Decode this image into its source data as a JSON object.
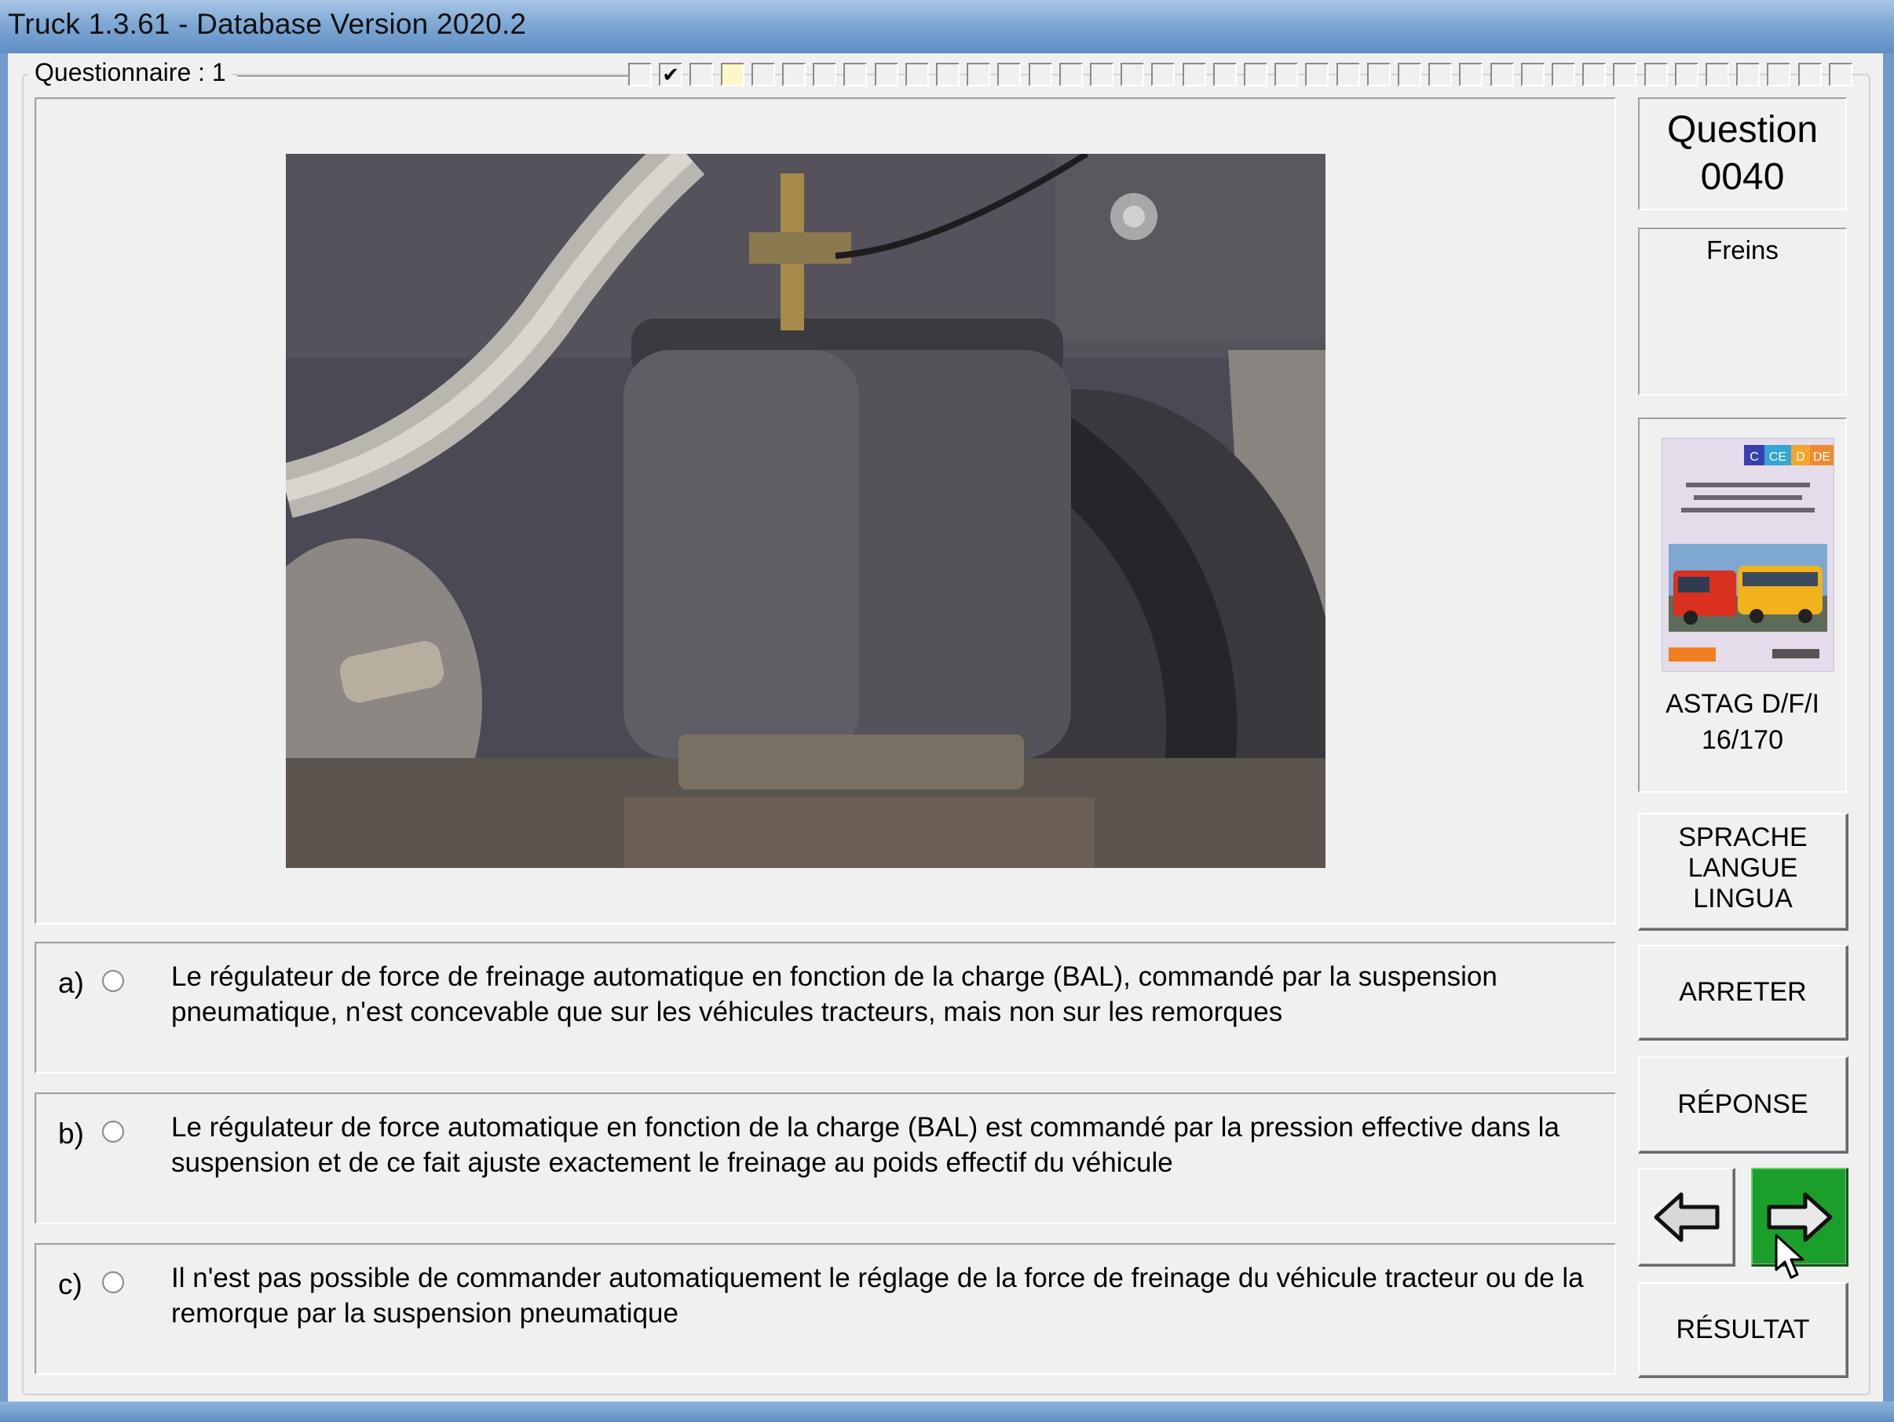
{
  "window": {
    "title": "Truck 1.3.61 - Database Version 2020.2"
  },
  "questionnaire": {
    "label": "Questionnaire : 1",
    "progress": {
      "total_boxes": 40,
      "checked_index": 1,
      "current_index": 3
    }
  },
  "question": {
    "title": "Question",
    "number": "0040",
    "category": "Freins"
  },
  "book": {
    "badge": [
      "C",
      "CE",
      "D",
      "DE"
    ],
    "line1": "ASTAG D/F/I",
    "line2": "16/170"
  },
  "answers": [
    {
      "letter": "a)",
      "text": "Le régulateur de force de freinage automatique en fonction de la charge (BAL), commandé par la suspension pneumatique, n'est concevable que sur les véhicules tracteurs, mais non sur les remorques",
      "selected": false
    },
    {
      "letter": "b)",
      "text": "Le régulateur de force automatique en fonction de la charge (BAL) est commandé par la pression effective dans la suspension et de ce fait ajuste exactement le freinage au poids effectif du véhicule",
      "selected": false
    },
    {
      "letter": "c)",
      "text": "Il n'est pas possible de commander automatiquement le réglage de la force de freinage du véhicule tracteur ou de la remorque par la suspension pneumatique",
      "selected": false
    }
  ],
  "buttons": {
    "language": [
      "SPRACHE",
      "LANGUE",
      "LINGUA"
    ],
    "stop": "ARRETER",
    "answer": "RÉPONSE",
    "result": "RÉSULTAT"
  },
  "icons": {
    "prev": "arrow-left-icon",
    "next": "arrow-right-icon"
  },
  "colors": {
    "next_button": "#1aa02a",
    "title_bar": "#7fa8d4"
  }
}
